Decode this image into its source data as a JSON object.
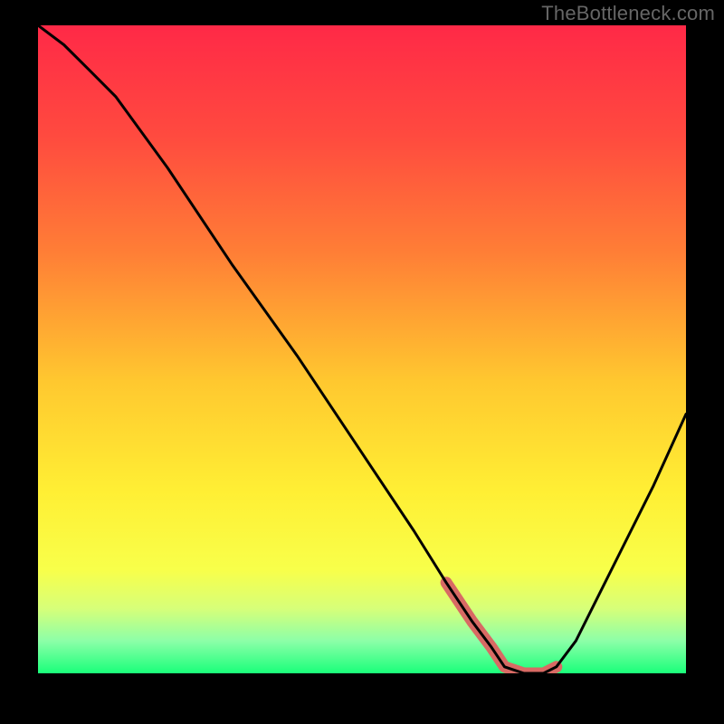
{
  "watermark": "TheBottleneck.com",
  "colors": {
    "background": "#000000",
    "curve": "#000000",
    "highlight": "#d86a64",
    "gradient_stops": [
      {
        "offset": 0.0,
        "color": "#ff2947"
      },
      {
        "offset": 0.17,
        "color": "#ff4a3f"
      },
      {
        "offset": 0.35,
        "color": "#ff7e36"
      },
      {
        "offset": 0.55,
        "color": "#ffc82f"
      },
      {
        "offset": 0.72,
        "color": "#ffef34"
      },
      {
        "offset": 0.84,
        "color": "#f8ff4a"
      },
      {
        "offset": 0.9,
        "color": "#d7ff79"
      },
      {
        "offset": 0.95,
        "color": "#8cffa8"
      },
      {
        "offset": 1.0,
        "color": "#1aff7a"
      }
    ]
  },
  "chart_data": {
    "type": "line",
    "title": "",
    "xlabel": "",
    "ylabel": "",
    "xlim": [
      0,
      100
    ],
    "ylim": [
      0,
      100
    ],
    "grid": false,
    "legend": false,
    "notes": "V-shaped bottleneck curve on rainbow gradient. y-axis shown inverted visually (high at top). Values are percentage positions; minimum (trough) around x≈72–80 at y≈0.",
    "series": [
      {
        "name": "curve",
        "x": [
          0,
          4,
          8,
          12,
          20,
          30,
          40,
          50,
          58,
          63,
          67,
          70,
          72,
          75,
          78,
          80,
          83,
          86,
          90,
          95,
          100
        ],
        "y": [
          100,
          97,
          93,
          89,
          78,
          63,
          49,
          34,
          22,
          14,
          8,
          4,
          1,
          0,
          0,
          1,
          5,
          11,
          19,
          29,
          40
        ]
      }
    ],
    "highlight_range": {
      "x_start": 63,
      "x_end": 82
    }
  }
}
